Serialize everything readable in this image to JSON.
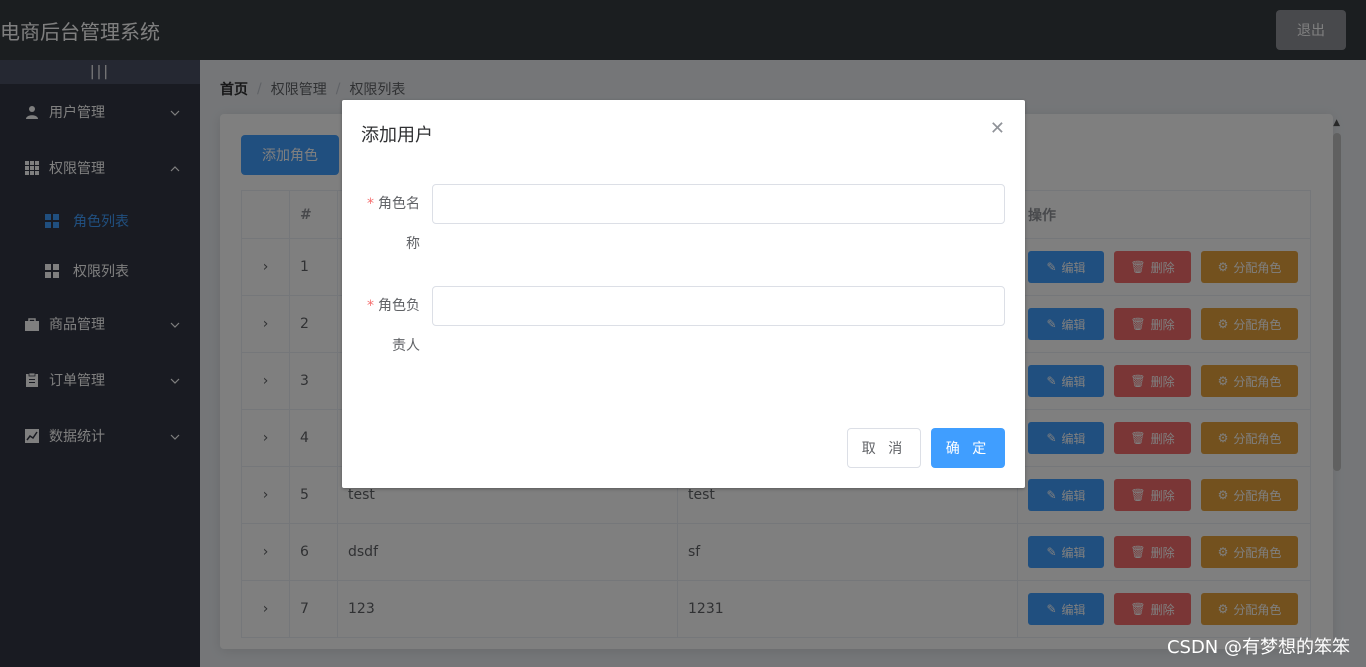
{
  "header": {
    "title": "电商后台管理系统",
    "logout_label": "退出"
  },
  "sidebar": {
    "toggle": "|||",
    "items": [
      {
        "label": "用户管理",
        "icon": "user-icon"
      },
      {
        "label": "权限管理",
        "icon": "grid-icon"
      },
      {
        "label": "商品管理",
        "icon": "shopping-bag-icon"
      },
      {
        "label": "订单管理",
        "icon": "clipboard-icon"
      },
      {
        "label": "数据统计",
        "icon": "chart-icon"
      }
    ],
    "sub_items": [
      {
        "label": "角色列表",
        "icon": "menu-grid-icon",
        "active": true
      },
      {
        "label": "权限列表",
        "icon": "menu-grid-icon",
        "active": false
      }
    ]
  },
  "breadcrumb": [
    "首页",
    "权限管理",
    "权限列表"
  ],
  "card": {
    "add_button": "添加角色",
    "columns": [
      "",
      "#",
      "",
      "",
      "操作"
    ],
    "rows": [
      {
        "index": "1",
        "name": "",
        "desc": ""
      },
      {
        "index": "2",
        "name": "",
        "desc": ""
      },
      {
        "index": "3",
        "name": "",
        "desc": ""
      },
      {
        "index": "4",
        "name": "",
        "desc": ""
      },
      {
        "index": "5",
        "name": "test",
        "desc": "test"
      },
      {
        "index": "6",
        "name": "dsdf",
        "desc": "sf"
      },
      {
        "index": "7",
        "name": "123",
        "desc": "1231"
      }
    ],
    "actions": {
      "edit": "编辑",
      "delete": "删除",
      "assign": "分配角色"
    }
  },
  "dialog": {
    "title": "添加用户",
    "fields": [
      {
        "label_line1": "角色名",
        "label_line2": "称",
        "value": ""
      },
      {
        "label_line1": "角色负",
        "label_line2": "责人",
        "value": ""
      }
    ],
    "cancel": "取 消",
    "ok": "确 定"
  },
  "watermark": "CSDN @有梦想的笨笨",
  "colors": {
    "primary": "#409eff",
    "danger": "#f56c6c",
    "warning": "#e6a23c",
    "header": "#373d41",
    "aside": "#333744"
  }
}
